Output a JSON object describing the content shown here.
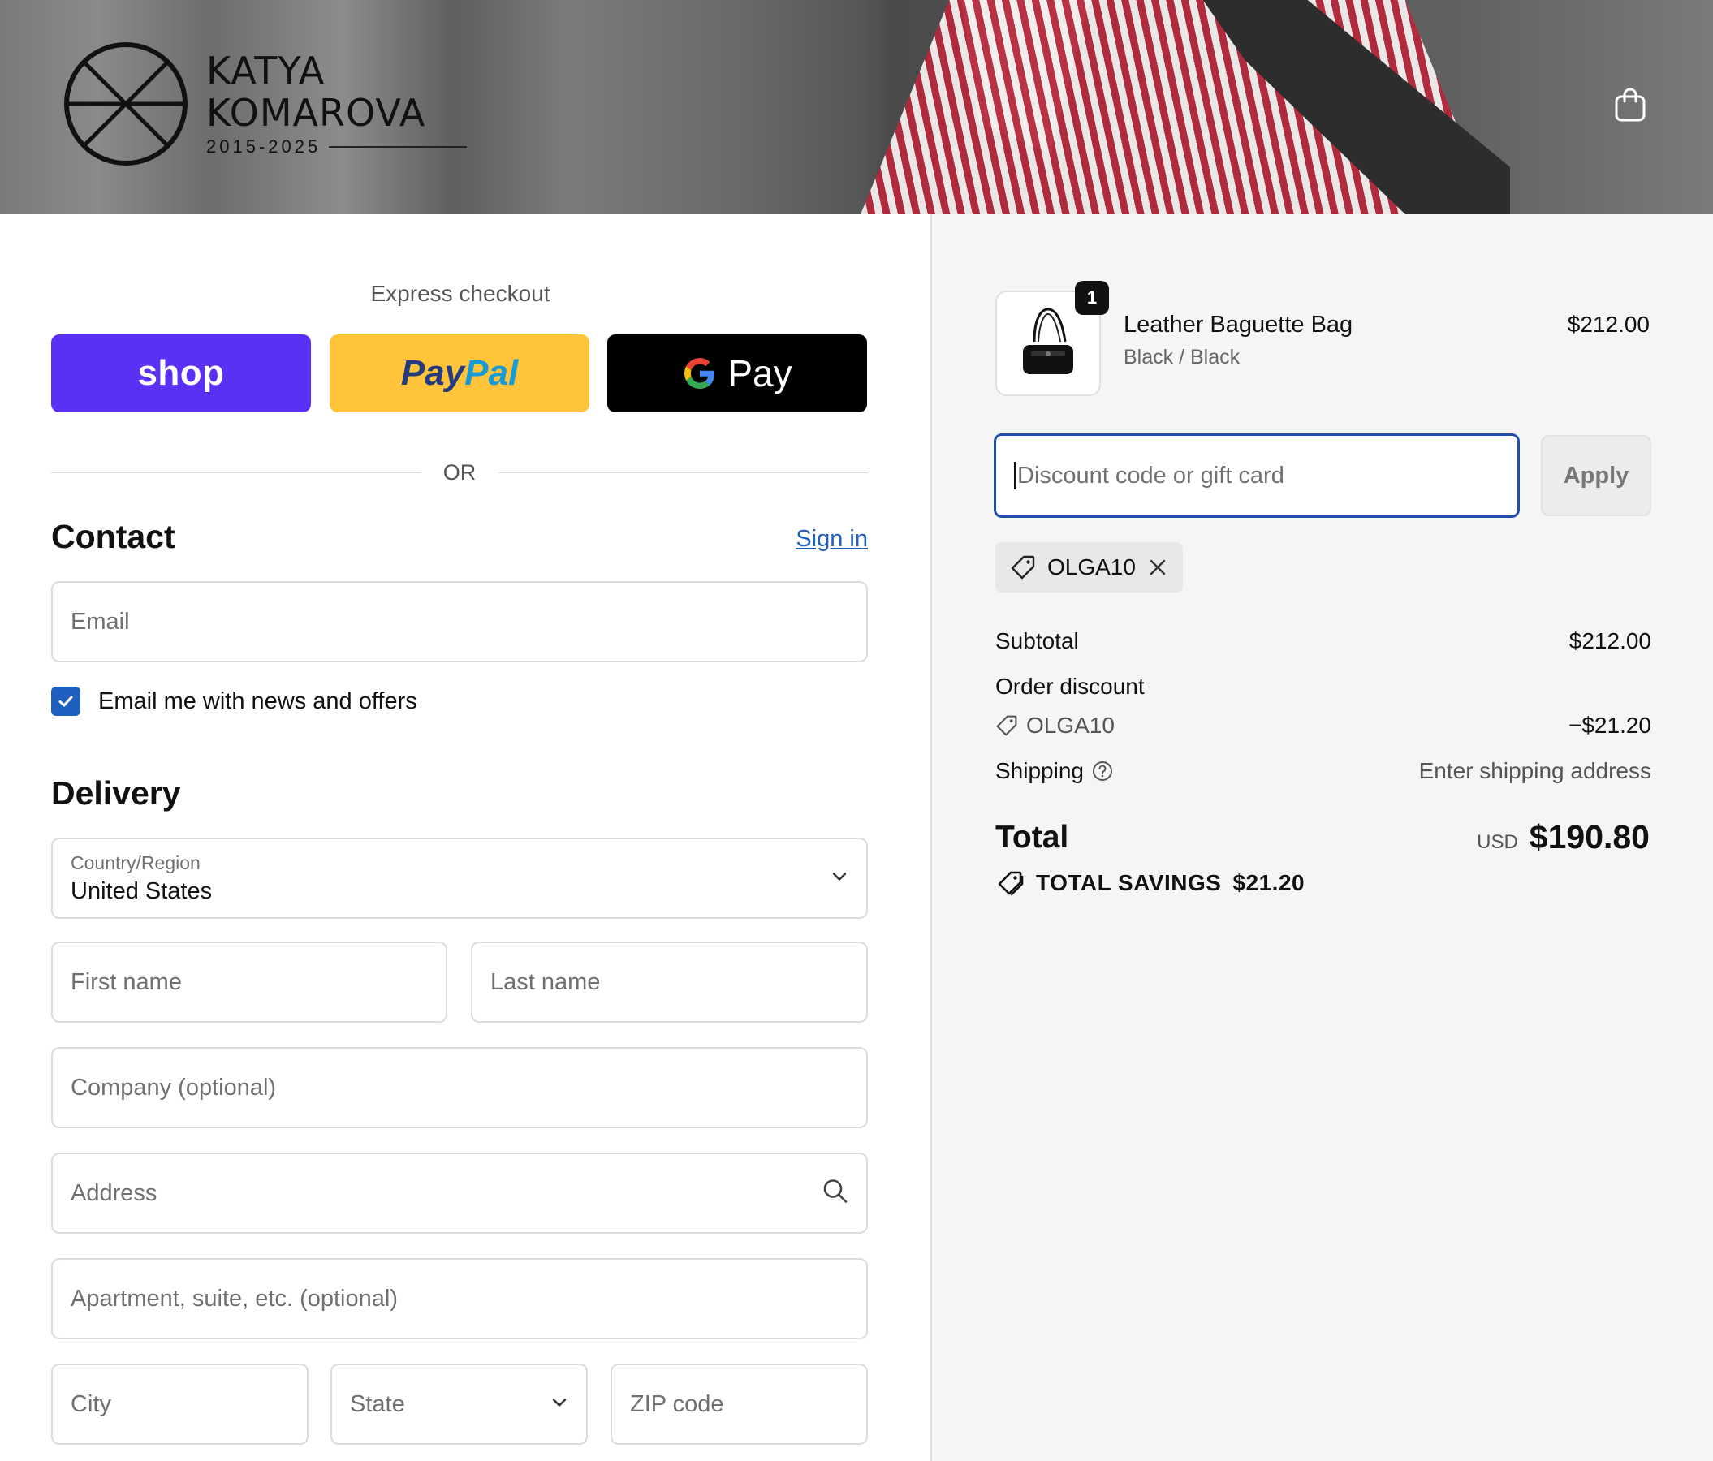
{
  "header": {
    "brand_line1": "KATYA",
    "brand_line2": "KOMAROVA",
    "brand_years": "2015-2025",
    "cart_icon": "shopping-bag-icon"
  },
  "express": {
    "title": "Express checkout",
    "shop_label": "shop",
    "paypal_part1": "Pay",
    "paypal_part2": "Pal",
    "gpay_g": "G",
    "gpay_label": "Pay",
    "or_label": "OR"
  },
  "contact": {
    "heading": "Contact",
    "sign_in": "Sign in",
    "email_placeholder": "Email",
    "newsletter_label": "Email me with news and offers",
    "newsletter_checked": true
  },
  "delivery": {
    "heading": "Delivery",
    "country_label": "Country/Region",
    "country_value": "United States",
    "first_name_placeholder": "First name",
    "last_name_placeholder": "Last name",
    "company_placeholder": "Company (optional)",
    "address_placeholder": "Address",
    "apartment_placeholder": "Apartment, suite, etc. (optional)",
    "city_placeholder": "City",
    "state_placeholder": "State",
    "zip_placeholder": "ZIP code"
  },
  "order": {
    "item": {
      "name": "Leather Baguette Bag",
      "variant": "Black / Black",
      "price": "$212.00",
      "quantity": "1"
    },
    "discount_placeholder": "Discount code or gift card",
    "apply_label": "Apply",
    "applied_code": "OLGA10",
    "subtotal_label": "Subtotal",
    "subtotal_value": "$212.00",
    "order_discount_label": "Order discount",
    "discount_code": "OLGA10",
    "discount_value": "−$21.20",
    "shipping_label": "Shipping",
    "shipping_value": "Enter shipping address",
    "total_label": "Total",
    "currency": "USD",
    "total_value": "$190.80",
    "savings_label": "TOTAL SAVINGS",
    "savings_value": "$21.20"
  },
  "colors": {
    "shop_purple": "#5a31f4",
    "paypal_yellow": "#ffc439",
    "link_blue": "#1f5fbf",
    "focus_blue": "#1f4fa8"
  }
}
